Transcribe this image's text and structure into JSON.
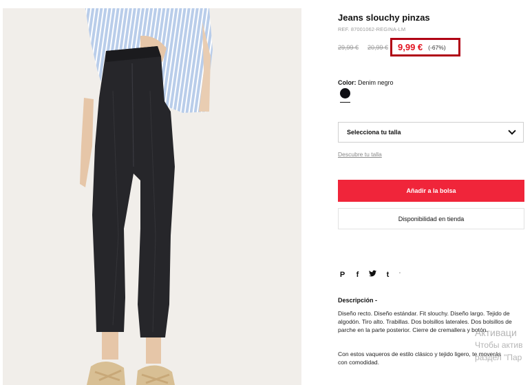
{
  "product": {
    "title": "Jeans slouchy pinzas",
    "ref": "REF. 87001062-REGINA-LM",
    "old_price_1": "29,99 €",
    "old_price_2": "20,99 €",
    "sale_price": "9,99 €",
    "discount": "(-67%)"
  },
  "color": {
    "label": "Color:",
    "value": "Denim negro",
    "swatch_color": "#0f0f14"
  },
  "size": {
    "select_label": "Selecciona tu talla",
    "guide_link": "Descubre tu talla"
  },
  "actions": {
    "add_to_bag": "Añadir a la bolsa",
    "store_availability": "Disponibilidad en tienda",
    "accent_color": "#f0253a"
  },
  "share": {
    "icons": [
      "pinterest-icon",
      "facebook-icon",
      "twitter-icon",
      "tumblr-icon"
    ],
    "pinterest": "P",
    "facebook": "f",
    "twitter": "t",
    "tumblr": "t",
    "more": "'"
  },
  "description": {
    "title": "Descripción -",
    "paragraph_1": "Diseño recto. Diseño estándar. Fit slouchy. Diseño largo. Tejido de algodón. Tiro alto. Trabillas. Dos bolsillos laterales. Dos bolsillos de parche en la parte posterior. Cierre de cremallera y botón.",
    "paragraph_2": "Con estos vaqueros de estilo clásico y tejido ligero, te moverás con comodidad."
  },
  "os_watermark": {
    "line_1": "Активаци",
    "line_2": "Чтобы актив",
    "line_3": "раздел \"Пар"
  }
}
